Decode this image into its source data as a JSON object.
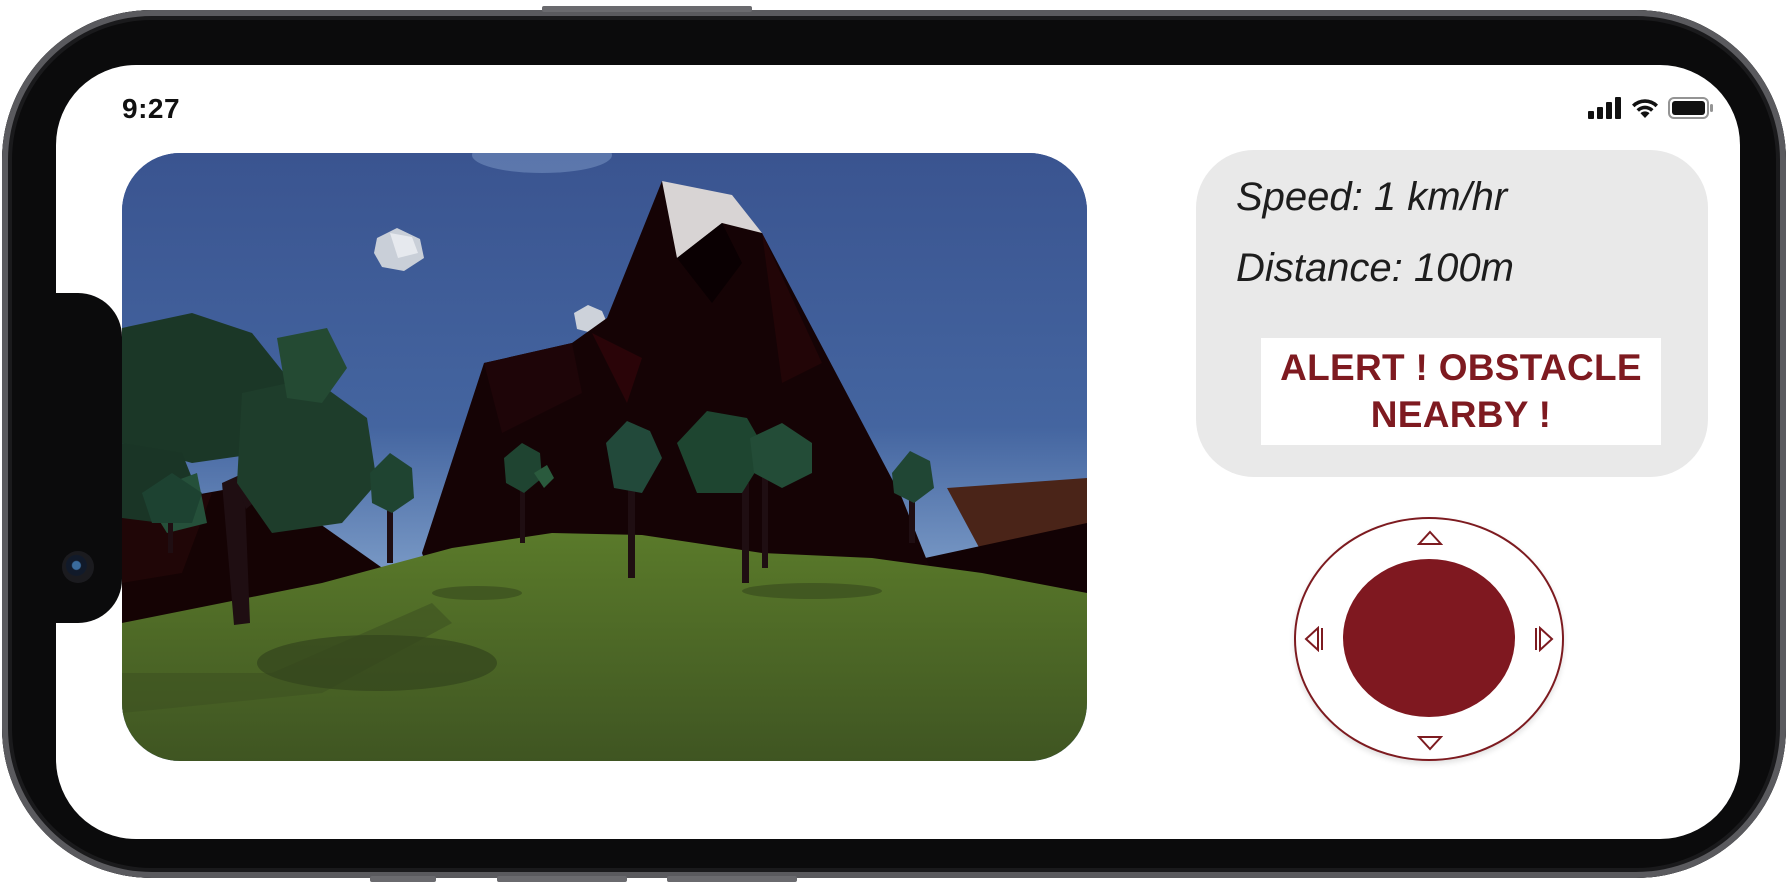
{
  "status_bar": {
    "time": "9:27",
    "icons": [
      "signal-icon",
      "wifi-icon",
      "battery-icon"
    ]
  },
  "game_view": {
    "scene": [
      "sky",
      "clouds",
      "low-poly-mountain",
      "low-poly-trees",
      "grass-field",
      "rocks"
    ]
  },
  "hud": {
    "speed_text": "Speed: 1 km/hr",
    "distance_text": "Distance: 100m",
    "alert_line1": "ALERT ! OBSTACLE",
    "alert_line2": "NEARBY !"
  },
  "joystick": {
    "directions": [
      "up",
      "down",
      "left",
      "right"
    ],
    "icons": [
      "arrow-up-icon",
      "arrow-down-icon",
      "arrow-left-icon",
      "arrow-right-icon"
    ]
  },
  "colors": {
    "accent": "#7f1820",
    "panel_bg": "#e9e9e9",
    "frame": "#0b0b0c",
    "sky": "#3a5590",
    "grass": "#4a6a26"
  }
}
